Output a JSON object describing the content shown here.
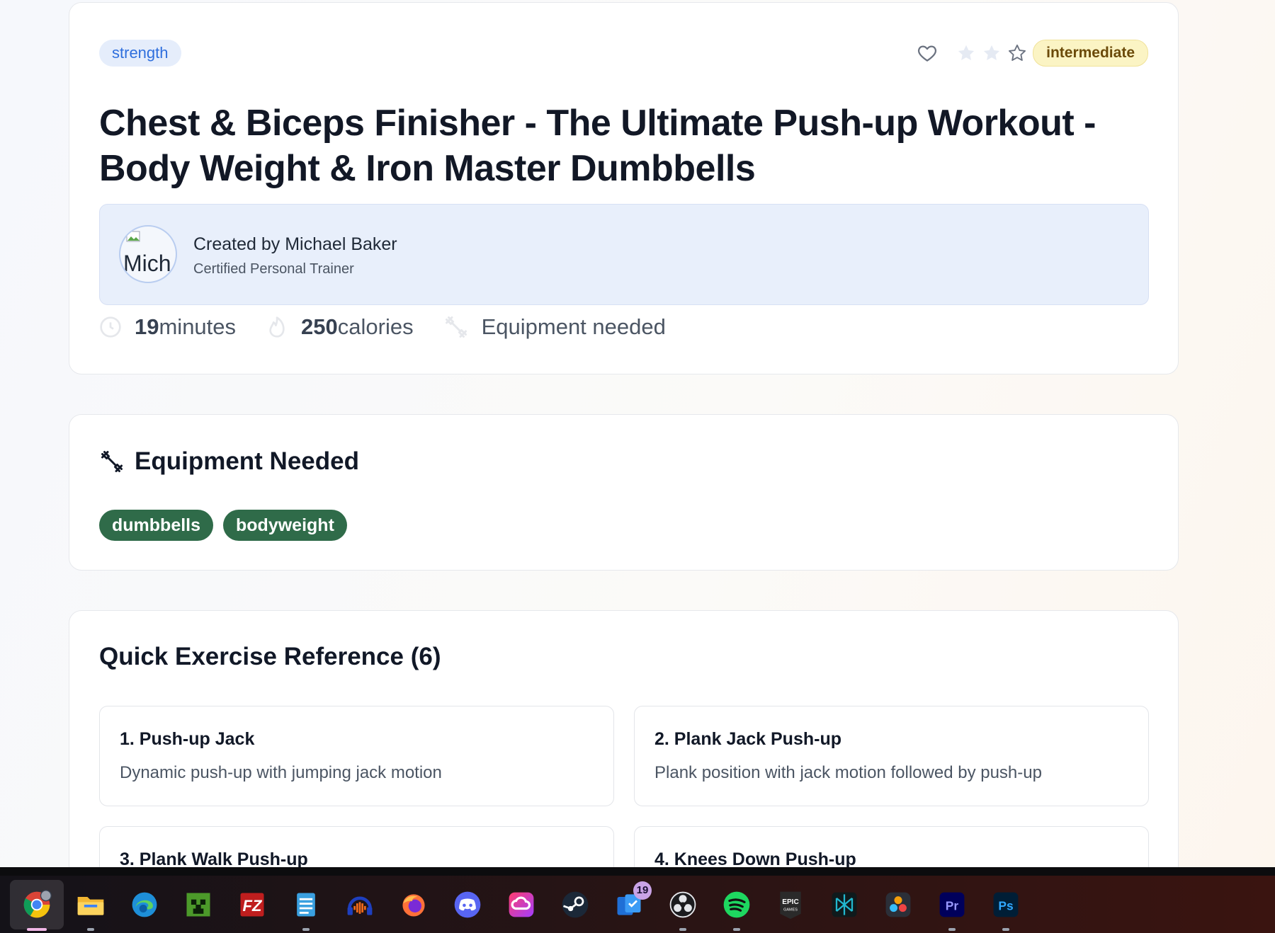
{
  "workout": {
    "category": "strength",
    "level": "intermediate",
    "rating": 2,
    "title_line1": "Chest & Biceps Finisher - The Ultimate Push-up Workout -",
    "title_line2": "Body Weight & Iron Master Dumbbells",
    "creator": {
      "avatar_alt": "Mich",
      "name": "Created by Michael Baker",
      "role": "Certified Personal Trainer"
    },
    "stats": {
      "minutes_value": "19",
      "minutes_unit": "minutes",
      "calories_value": "250",
      "calories_unit": "calories",
      "equipment_label": "Equipment needed"
    }
  },
  "equipment": {
    "heading": "Equipment Needed",
    "items": [
      "dumbbells",
      "bodyweight"
    ]
  },
  "quick_reference": {
    "heading": "Quick Exercise Reference (6)",
    "exercises": [
      {
        "name": "1. Push-up Jack",
        "description": "Dynamic push-up with jumping jack motion"
      },
      {
        "name": "2. Plank Jack Push-up",
        "description": "Plank position with jack motion followed by push-up"
      },
      {
        "name": "3. Plank Walk Push-up",
        "description": ""
      },
      {
        "name": "4. Knees Down Push-up",
        "description": ""
      }
    ]
  },
  "taskbar": {
    "apps": [
      {
        "icon": "chrome-icon",
        "active": true
      },
      {
        "icon": "file-explorer-icon",
        "running": true
      },
      {
        "icon": "edge-icon"
      },
      {
        "icon": "minecraft-icon"
      },
      {
        "icon": "filezilla-icon"
      },
      {
        "icon": "notepad-icon",
        "running": true
      },
      {
        "icon": "audacity-icon"
      },
      {
        "icon": "firefox-icon"
      },
      {
        "icon": "discord-icon"
      },
      {
        "icon": "creative-cloud-icon"
      },
      {
        "icon": "steam-icon"
      },
      {
        "icon": "task-app-icon",
        "badge": "19"
      },
      {
        "icon": "obs-icon",
        "running": true
      },
      {
        "icon": "spotify-icon",
        "running": true
      },
      {
        "icon": "epic-games-icon"
      },
      {
        "icon": "perplexity-icon"
      },
      {
        "icon": "davinci-resolve-icon"
      },
      {
        "icon": "premiere-pro-icon",
        "running": true
      },
      {
        "icon": "photoshop-icon",
        "running": true
      }
    ],
    "colors": {
      "accent": "#f0b6e6",
      "badge": "#c9a3e6"
    }
  },
  "colors": {
    "strength_tag": "#2f6fdd",
    "level_badge_bg": "#fbf4c4",
    "equipment_pill": "#2f6b49",
    "creator_box": "#e8effb"
  }
}
